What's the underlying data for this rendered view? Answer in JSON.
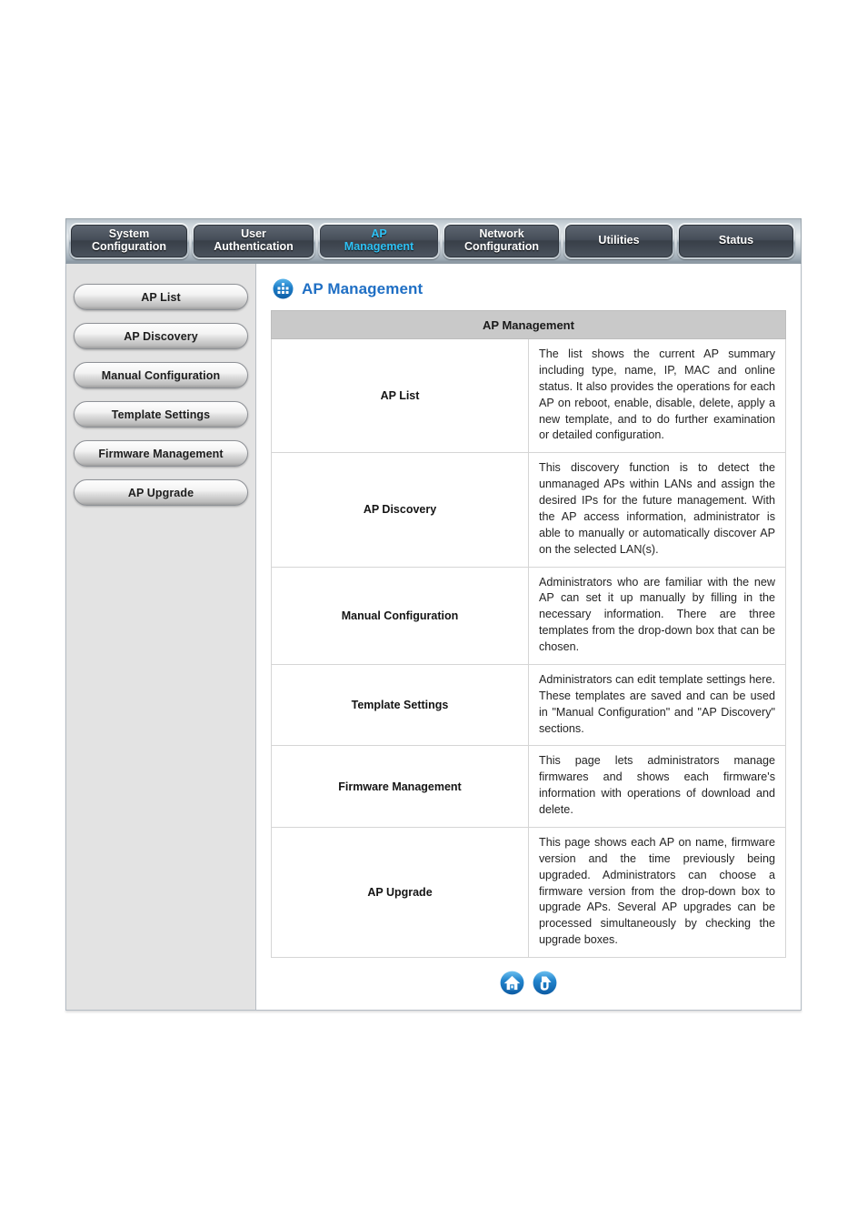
{
  "tabs": [
    {
      "id": "system-configuration",
      "lines": [
        "System",
        "Configuration"
      ],
      "active": false
    },
    {
      "id": "user-authentication",
      "lines": [
        "User",
        "Authentication"
      ],
      "active": false
    },
    {
      "id": "ap-management",
      "lines": [
        "AP",
        "Management"
      ],
      "active": true
    },
    {
      "id": "network-configuration",
      "lines": [
        "Network",
        "Configuration"
      ],
      "active": false
    },
    {
      "id": "utilities",
      "lines": [
        "Utilities"
      ],
      "active": false
    },
    {
      "id": "status",
      "lines": [
        "Status"
      ],
      "active": false
    }
  ],
  "sidebar": {
    "items": [
      {
        "id": "ap-list",
        "label": "AP List"
      },
      {
        "id": "ap-discovery",
        "label": "AP Discovery"
      },
      {
        "id": "manual-configuration",
        "label": "Manual Configuration"
      },
      {
        "id": "template-settings",
        "label": "Template Settings"
      },
      {
        "id": "firmware-management",
        "label": "Firmware Management"
      },
      {
        "id": "ap-upgrade",
        "label": "AP Upgrade"
      }
    ]
  },
  "page": {
    "title": "AP Management",
    "icon": "grid-icon"
  },
  "table": {
    "caption": "AP Management",
    "rows": [
      {
        "id": "ap-list",
        "name": "AP List",
        "description": "The list shows the current AP summary including type, name, IP, MAC and online status. It also provides the operations for each AP on reboot, enable, disable, delete, apply a new template, and to do further examination or detailed configuration."
      },
      {
        "id": "ap-discovery",
        "name": "AP Discovery",
        "description": "This discovery function is to detect the unmanaged APs within LANs and assign the desired IPs for the future management. With the AP access information, administrator is able to manually or automatically discover AP on the selected LAN(s)."
      },
      {
        "id": "manual-configuration",
        "name": "Manual Configuration",
        "description": "Administrators who are familiar with the new AP can set it up manually by filling in the necessary information. There are three templates from the drop-down box that can be chosen."
      },
      {
        "id": "template-settings",
        "name": "Template Settings",
        "description": "Administrators can edit template settings here. These templates are saved and can be used in \"Manual Configuration\" and \"AP Discovery\" sections."
      },
      {
        "id": "firmware-management",
        "name": "Firmware Management",
        "description": "This page lets administrators manage firmwares and shows each firmware's information with operations of download and delete."
      },
      {
        "id": "ap-upgrade",
        "name": "AP Upgrade",
        "description": "This page shows each AP on name, firmware version and the time previously being upgraded. Administrators can choose a firmware version from the drop-down box to upgrade APs. Several AP upgrades can be processed simultaneously by checking the upgrade boxes."
      }
    ]
  },
  "footer": {
    "icons": [
      {
        "id": "home",
        "name": "home-icon"
      },
      {
        "id": "top",
        "name": "back-to-top-icon"
      }
    ]
  },
  "colors": {
    "accent_blue": "#1f6fc4",
    "active_tab_text": "#2ec2f5",
    "table_header": "#c9c9c9",
    "sidebar_bg": "#e3e3e3"
  }
}
